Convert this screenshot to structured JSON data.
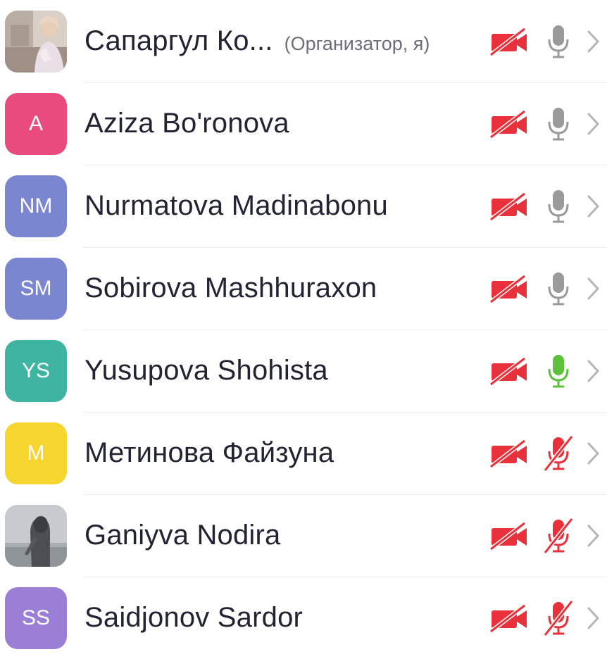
{
  "participants": [
    {
      "name": "Сапаргул Ко...",
      "role": "(Организатор, я)",
      "avatar_type": "photo-woman",
      "avatar_initials": "",
      "avatar_color": "#c9b8a8",
      "video": "off",
      "audio": "muted-available"
    },
    {
      "name": "Aziza Bo'ronova",
      "role": "",
      "avatar_type": "initials",
      "avatar_initials": "A",
      "avatar_color": "#e94b7f",
      "video": "off",
      "audio": "muted-available"
    },
    {
      "name": "Nurmatova Madinabonu",
      "role": "",
      "avatar_type": "initials",
      "avatar_initials": "NM",
      "avatar_color": "#7b86d1",
      "video": "off",
      "audio": "muted-available"
    },
    {
      "name": "Sobirova Mashhuraxon",
      "role": "",
      "avatar_type": "initials",
      "avatar_initials": "SM",
      "avatar_color": "#7b86d1",
      "video": "off",
      "audio": "muted-available"
    },
    {
      "name": "Yusupova Shohista",
      "role": "",
      "avatar_type": "initials",
      "avatar_initials": "YS",
      "avatar_color": "#3fb4a0",
      "video": "off",
      "audio": "on"
    },
    {
      "name": "Метинова Файзуна",
      "role": "",
      "avatar_type": "initials",
      "avatar_initials": "M",
      "avatar_color": "#f6d52e",
      "video": "off",
      "audio": "off"
    },
    {
      "name": "Ganiyva Nodira",
      "role": "",
      "avatar_type": "photo-hooded",
      "avatar_initials": "",
      "avatar_color": "#b4b9bd",
      "video": "off",
      "audio": "off"
    },
    {
      "name": "Saidjonov Sardor",
      "role": "",
      "avatar_type": "initials",
      "avatar_initials": "SS",
      "avatar_color": "#9b7fd6",
      "video": "off",
      "audio": "off"
    }
  ],
  "colors": {
    "muted_red": "#e8313a",
    "mic_gray": "#9a9a9a",
    "mic_green": "#5cc03a",
    "chevron_gray": "#b5b5b5",
    "name_text": "#232333",
    "role_text": "#6e6e78"
  },
  "icons": {
    "camera_off": "video-off-icon",
    "mic_gray": "microphone-icon",
    "mic_green": "microphone-active-icon",
    "mic_off": "microphone-off-icon",
    "chevron": "chevron-right-icon"
  }
}
